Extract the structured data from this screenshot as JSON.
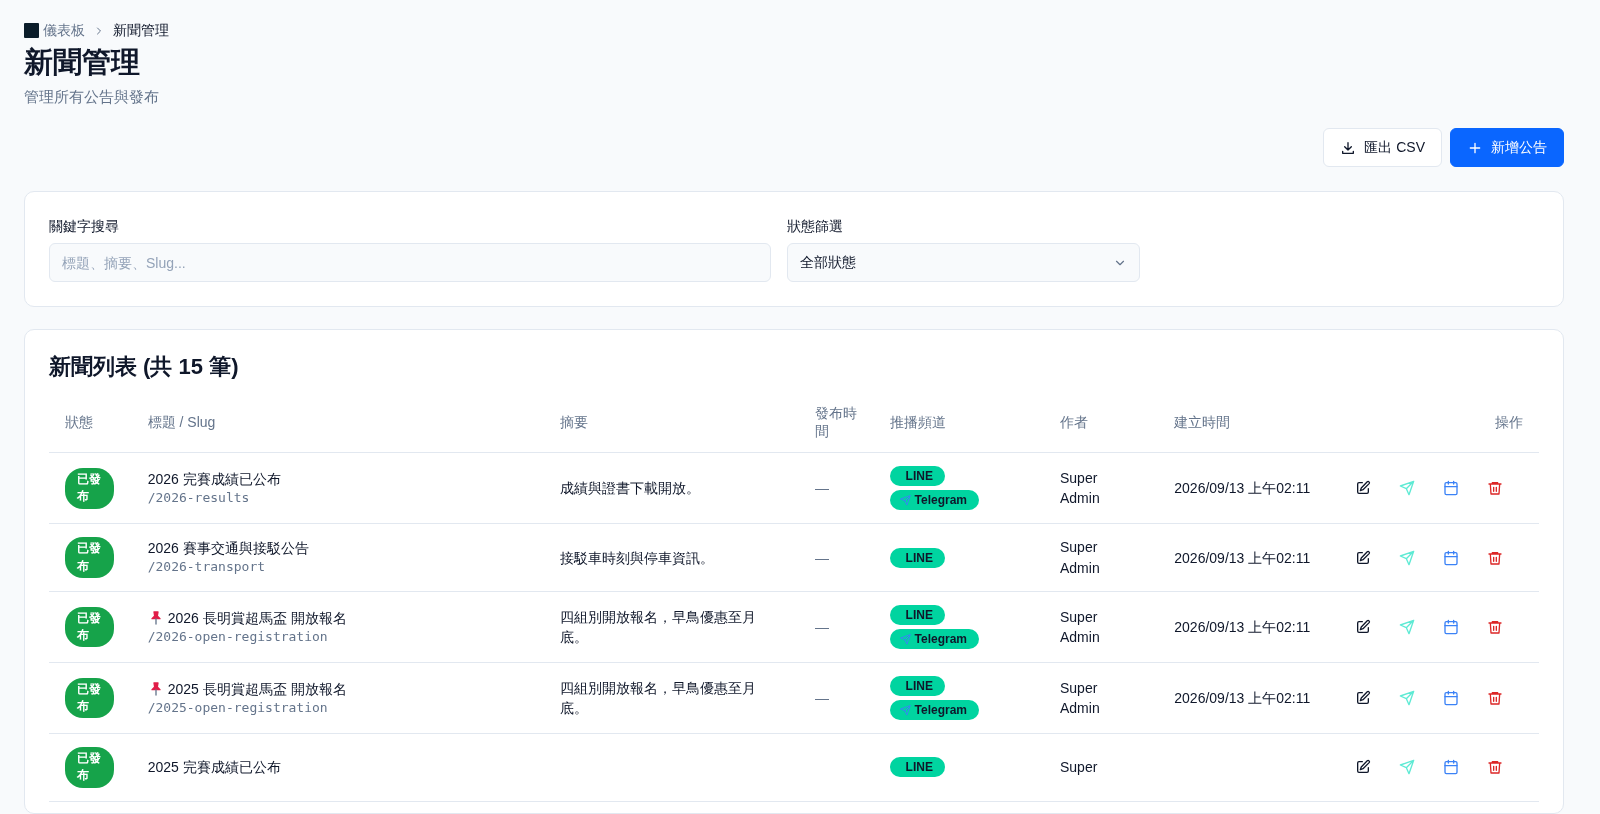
{
  "breadcrumb": [
    {
      "label": "儀表板",
      "kind": "home"
    },
    {
      "label": "新聞管理",
      "kind": "current"
    }
  ],
  "page": {
    "title": "新聞管理",
    "subtitle": "管理所有公告與發布"
  },
  "toolbar": {
    "buttons": [
      {
        "label": "匯出 CSV",
        "kind": "export"
      },
      {
        "label": "新增公告",
        "kind": "add"
      }
    ]
  },
  "filters": {
    "keyword": {
      "label": "關鍵字搜尋",
      "placeholder": "標題、摘要、Slug..."
    },
    "status": {
      "label": "狀態篩選",
      "value": "全部狀態"
    }
  },
  "table": {
    "title": "新聞列表 (共 15 筆)",
    "columns": [
      "狀態",
      "標題 / Slug",
      "摘要",
      "發布時間",
      "推播頻道",
      "作者",
      "建立時間",
      "操作"
    ],
    "rows": [
      {
        "status": "已發布",
        "pinned": false,
        "title": "2026 完賽成績已公布",
        "slug": "/2026-results",
        "summary": "成績與證書下載開放。",
        "published": "—",
        "channels": [
          {
            "label": "LINE",
            "kind": "line"
          },
          {
            "label": "Telegram",
            "kind": "telegram"
          }
        ],
        "author": "Super Admin",
        "created": "2026/09/13 上午02:11"
      },
      {
        "status": "已發布",
        "pinned": false,
        "title": "2026 賽事交通與接駁公告",
        "slug": "/2026-transport",
        "summary": "接駁車時刻與停車資訊。",
        "published": "—",
        "channels": [
          {
            "label": "LINE",
            "kind": "line"
          }
        ],
        "author": "Super Admin",
        "created": "2026/09/13 上午02:11"
      },
      {
        "status": "已發布",
        "pinned": true,
        "title": "2026 長明賞超馬盃 開放報名",
        "slug": "/2026-open-registration",
        "summary": "四組別開放報名，早鳥優惠至月底。",
        "published": "—",
        "channels": [
          {
            "label": "LINE",
            "kind": "line"
          },
          {
            "label": "Telegram",
            "kind": "telegram"
          }
        ],
        "author": "Super Admin",
        "created": "2026/09/13 上午02:11"
      },
      {
        "status": "已發布",
        "pinned": true,
        "title": "2025 長明賞超馬盃 開放報名",
        "slug": "/2025-open-registration",
        "summary": "四組別開放報名，早鳥優惠至月底。",
        "published": "—",
        "channels": [
          {
            "label": "LINE",
            "kind": "line"
          },
          {
            "label": "Telegram",
            "kind": "telegram"
          }
        ],
        "author": "Super Admin",
        "created": "2026/09/13 上午02:11"
      },
      {
        "status": "已發布",
        "pinned": false,
        "title": "2025 完賽成績已公布",
        "channels": [
          {
            "label": "LINE",
            "kind": "line"
          }
        ],
        "author": "Super"
      }
    ]
  }
}
